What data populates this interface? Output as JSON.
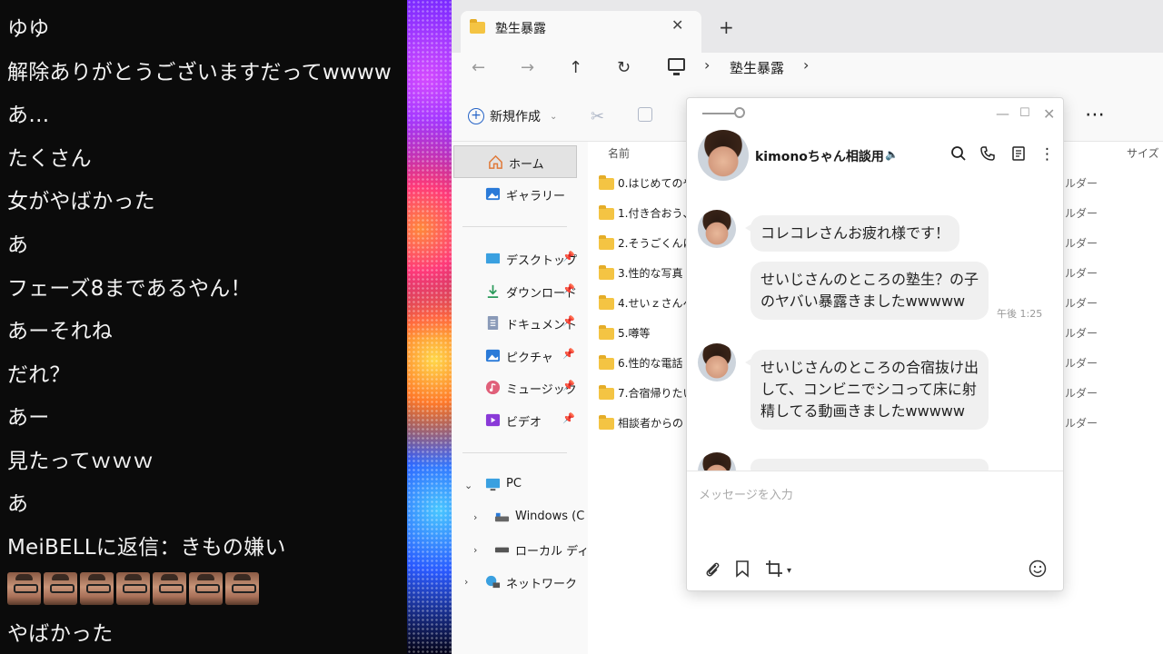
{
  "stream": {
    "lines": [
      "ゆゆ",
      "解除ありがとうございますだってwwww",
      "あ…",
      "たくさん",
      "女がやばかった",
      "あ",
      "フェーズ8まであるやん！",
      "あーそれね",
      "だれ？",
      "あー",
      "見たってｗｗｗ",
      "あ",
      "MeiBELLに返信：きもの嫌い",
      "やばかった"
    ]
  },
  "explorer": {
    "tab_title": "塾生暴露",
    "tab_close": "✕",
    "tab_new": "+",
    "nav": {
      "back": "←",
      "forward": "→",
      "up": "↑",
      "refresh": "↻",
      "chevron": "›"
    },
    "breadcrumb": "塾生暴露",
    "new_label": "新規作成",
    "more": "⋯",
    "nav_items": {
      "home": "ホーム",
      "gallery": "ギャラリー",
      "desktop": "デスクトップ",
      "downloads": "ダウンロード",
      "documents": "ドキュメント",
      "pictures": "ピクチャ",
      "music": "ミュージック",
      "videos": "ビデオ",
      "pc": "PC",
      "windows": "Windows (C",
      "local": "ローカル ディ",
      "network": "ネットワーク"
    },
    "columns": {
      "name": "名前",
      "size": "サイズ"
    },
    "files": [
      {
        "name": "0.はじめてのや",
        "type": "ルダー"
      },
      {
        "name": "1.付き合おう、",
        "type": "ルダー"
      },
      {
        "name": "2.そうごくんにア",
        "type": "ルダー"
      },
      {
        "name": "3.性的な写真",
        "type": "ルダー"
      },
      {
        "name": "4.せいｚさんへ",
        "type": "ルダー"
      },
      {
        "name": "5.噂等",
        "type": "ルダー"
      },
      {
        "name": "6.性的な電話",
        "type": "ルダー"
      },
      {
        "name": "7.合宿帰りたい",
        "type": "ルダー"
      },
      {
        "name": "相談者からの",
        "type": "ルダー"
      }
    ]
  },
  "chat": {
    "title": "kimonoちゃん相談用",
    "messages": [
      {
        "text": "コレコレさんお疲れ様です！"
      },
      {
        "text": "せいじさんのところの塾生？の子のヤバい暴露きましたwwwww",
        "time": "午後 1:25"
      },
      {
        "text": "せいじさんのところの合宿抜け出して、コンビニでシコって床に射精してる動画きましたwwwww"
      }
    ],
    "input_placeholder": "メッセージを入力"
  }
}
